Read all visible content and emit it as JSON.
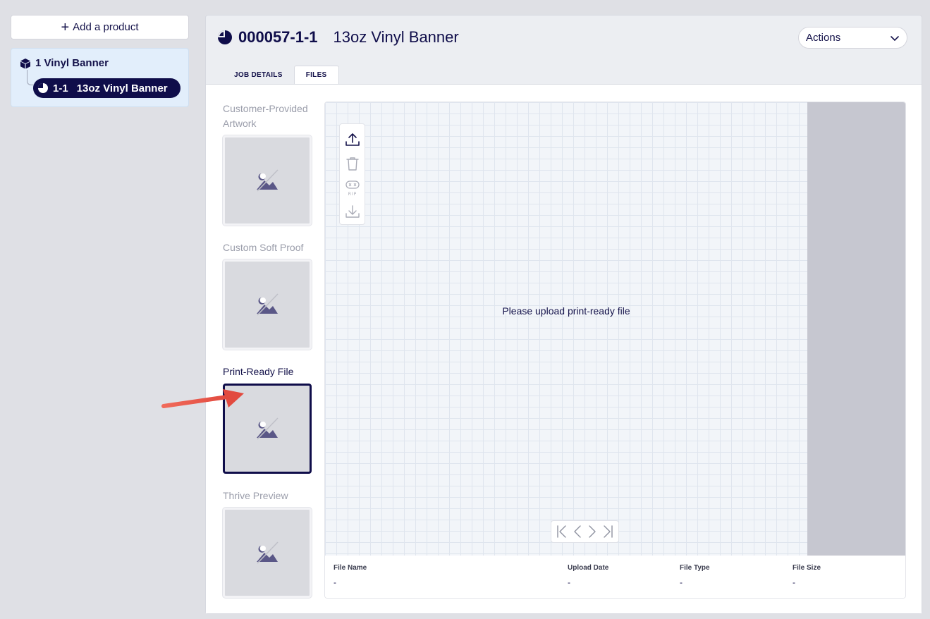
{
  "left": {
    "add_product_label": "Add a product",
    "tree": {
      "root_label": "1 Vinyl Banner",
      "child_number": "1-1",
      "child_label": "13oz Vinyl Banner"
    }
  },
  "header": {
    "job_number": "000057-1-1",
    "job_title": "13oz Vinyl Banner",
    "actions_label": "Actions"
  },
  "tabs": [
    {
      "label": "JOB DETAILS",
      "active": false
    },
    {
      "label": "FILES",
      "active": true
    }
  ],
  "thumbnails": [
    {
      "label": "Customer-Provided Artwork",
      "active": false
    },
    {
      "label": "Custom Soft Proof",
      "active": false
    },
    {
      "label": "Print-Ready File",
      "active": true
    },
    {
      "label": "Thrive Preview",
      "active": false
    }
  ],
  "viewer": {
    "message": "Please upload print-ready file",
    "tools": [
      "upload-icon",
      "trash-icon",
      "rip-icon",
      "download-icon"
    ],
    "rip_label": "RIP"
  },
  "file_table": {
    "columns": [
      {
        "header": "File Name",
        "value": "-"
      },
      {
        "header": "Upload Date",
        "value": "-"
      },
      {
        "header": "File Type",
        "value": "-"
      },
      {
        "header": "File Size",
        "value": "-"
      }
    ]
  },
  "colors": {
    "navy": "#0f0d4a",
    "background": "#dfe0e5",
    "tree_bg": "#e2eefb",
    "arrow": "#e8564a"
  }
}
